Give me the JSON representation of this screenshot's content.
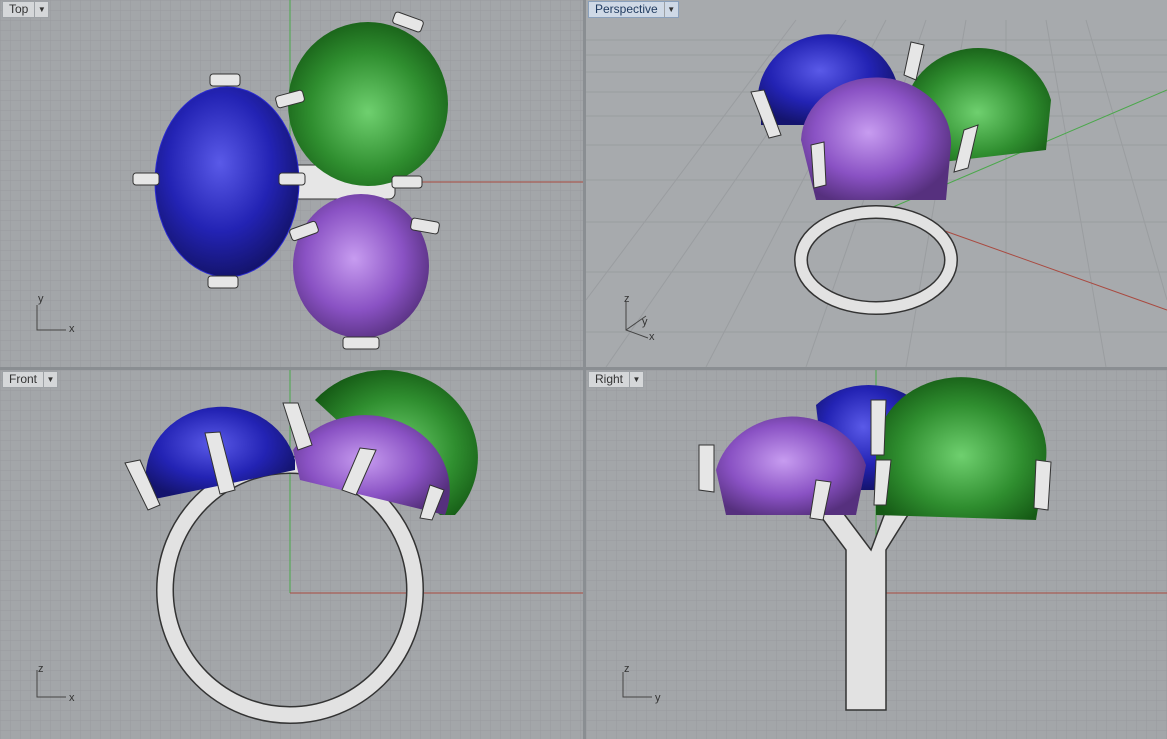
{
  "viewports": [
    {
      "id": "top",
      "label": "Top",
      "axis": [
        "y",
        "x"
      ]
    },
    {
      "id": "perspective",
      "label": "Perspective",
      "axis": [
        "z",
        "y",
        "x"
      ]
    },
    {
      "id": "front",
      "label": "Front",
      "axis": [
        "z",
        "x"
      ]
    },
    {
      "id": "right",
      "label": "Right",
      "axis": [
        "z",
        "y"
      ]
    }
  ],
  "icons": {
    "dropdown": "chevron-down-icon"
  },
  "colors": {
    "grid_bg": "#a3a6a9",
    "grid_line": "#979a9d",
    "grid_major": "#8d9093",
    "x_axis": "#a94a40",
    "y_axis": "#4aa84a",
    "gem_blue": "#2a2ab8",
    "gem_green": "#2d8a2d",
    "gem_purple": "#8a4fc0",
    "metal": "#e4e4e4",
    "active_label": "#cfd9e6"
  }
}
